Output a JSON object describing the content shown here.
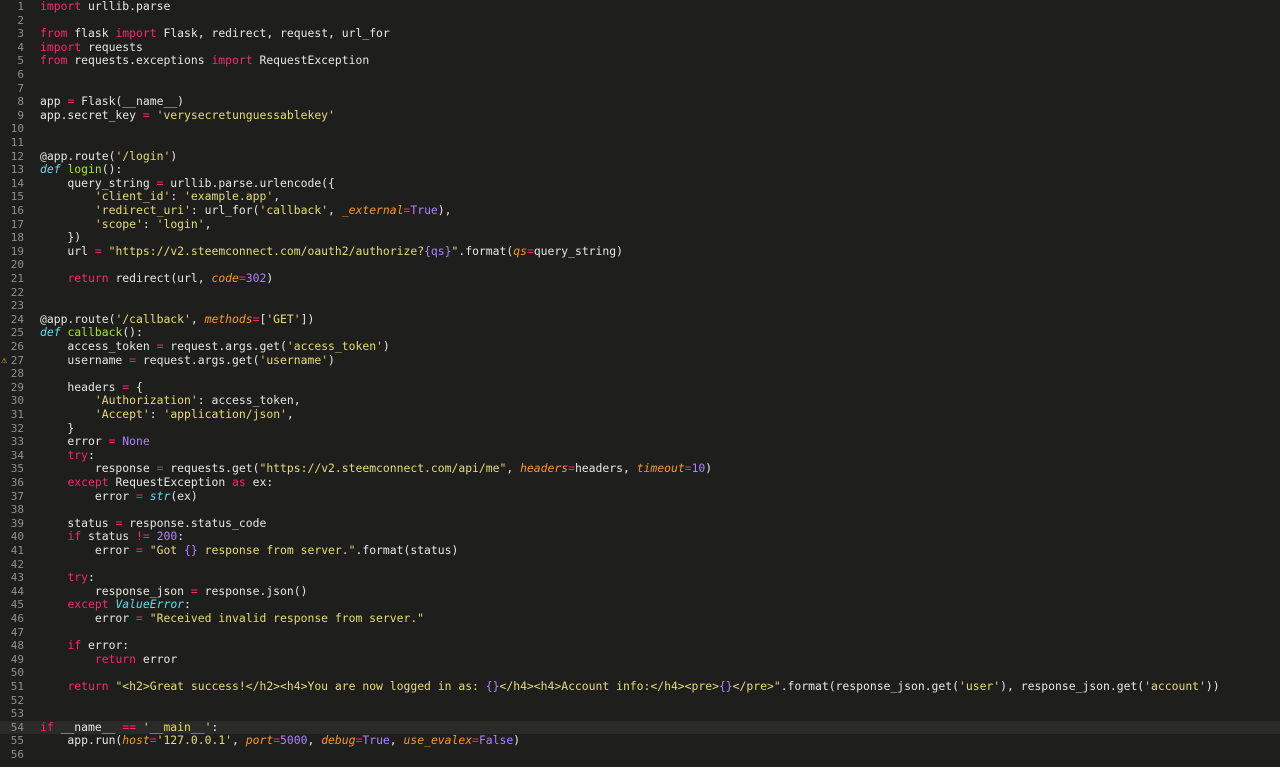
{
  "editor": {
    "warning_line": 27,
    "active_line": 54,
    "lines": [
      {
        "n": "1",
        "t": [
          [
            "kw",
            "import"
          ],
          [
            "plain",
            " urllib.parse"
          ]
        ]
      },
      {
        "n": "2",
        "t": []
      },
      {
        "n": "3",
        "t": [
          [
            "kw",
            "from"
          ],
          [
            "plain",
            " flask "
          ],
          [
            "kw",
            "import"
          ],
          [
            "plain",
            " Flask, redirect, request, url_for"
          ]
        ]
      },
      {
        "n": "4",
        "t": [
          [
            "kw",
            "import"
          ],
          [
            "plain",
            " requests"
          ]
        ]
      },
      {
        "n": "5",
        "t": [
          [
            "kw",
            "from"
          ],
          [
            "plain",
            " requests.exceptions "
          ],
          [
            "kw",
            "import"
          ],
          [
            "plain",
            " RequestException"
          ]
        ]
      },
      {
        "n": "6",
        "t": []
      },
      {
        "n": "7",
        "t": []
      },
      {
        "n": "8",
        "t": [
          [
            "plain",
            "app "
          ],
          [
            "op",
            "="
          ],
          [
            "plain",
            " Flask(__name__)"
          ]
        ]
      },
      {
        "n": "9",
        "t": [
          [
            "plain",
            "app.secret_key "
          ],
          [
            "op",
            "="
          ],
          [
            "plain",
            " "
          ],
          [
            "str",
            "'verysecretunguessablekey'"
          ]
        ]
      },
      {
        "n": "10",
        "t": []
      },
      {
        "n": "11",
        "t": []
      },
      {
        "n": "12",
        "t": [
          [
            "plain",
            "@app.route("
          ],
          [
            "str",
            "'/login'"
          ],
          [
            "plain",
            ")"
          ]
        ]
      },
      {
        "n": "13",
        "t": [
          [
            "kwi",
            "def"
          ],
          [
            "plain",
            " "
          ],
          [
            "fn",
            "login"
          ],
          [
            "plain",
            "():"
          ]
        ]
      },
      {
        "n": "14",
        "t": [
          [
            "plain",
            "    query_string "
          ],
          [
            "op",
            "="
          ],
          [
            "plain",
            " urllib.parse.urlencode({"
          ]
        ]
      },
      {
        "n": "15",
        "t": [
          [
            "plain",
            "        "
          ],
          [
            "str",
            "'client_id'"
          ],
          [
            "plain",
            ": "
          ],
          [
            "str",
            "'example.app'"
          ],
          [
            "plain",
            ","
          ]
        ]
      },
      {
        "n": "16",
        "t": [
          [
            "plain",
            "        "
          ],
          [
            "str",
            "'redirect_uri'"
          ],
          [
            "plain",
            ": url_for("
          ],
          [
            "str",
            "'callback'"
          ],
          [
            "plain",
            ", "
          ],
          [
            "param",
            "_external"
          ],
          [
            "op",
            "="
          ],
          [
            "num",
            "True"
          ],
          [
            "plain",
            "),"
          ]
        ]
      },
      {
        "n": "17",
        "t": [
          [
            "plain",
            "        "
          ],
          [
            "str",
            "'scope'"
          ],
          [
            "plain",
            ": "
          ],
          [
            "str",
            "'login'"
          ],
          [
            "plain",
            ","
          ]
        ]
      },
      {
        "n": "18",
        "t": [
          [
            "plain",
            "    })"
          ]
        ]
      },
      {
        "n": "19",
        "t": [
          [
            "plain",
            "    url "
          ],
          [
            "op",
            "="
          ],
          [
            "plain",
            " "
          ],
          [
            "str",
            "\"https://v2.steemconnect.com/oauth2/authorize?"
          ],
          [
            "interp",
            "{qs}"
          ],
          [
            "str",
            "\""
          ],
          [
            "plain",
            ".format("
          ],
          [
            "param",
            "qs"
          ],
          [
            "op",
            "="
          ],
          [
            "plain",
            "query_string)"
          ]
        ]
      },
      {
        "n": "20",
        "t": []
      },
      {
        "n": "21",
        "t": [
          [
            "plain",
            "    "
          ],
          [
            "kw",
            "return"
          ],
          [
            "plain",
            " redirect(url, "
          ],
          [
            "param",
            "code"
          ],
          [
            "op",
            "="
          ],
          [
            "num",
            "302"
          ],
          [
            "plain",
            ")"
          ]
        ]
      },
      {
        "n": "22",
        "t": []
      },
      {
        "n": "23",
        "t": []
      },
      {
        "n": "24",
        "t": [
          [
            "plain",
            "@app.route("
          ],
          [
            "str",
            "'/callback'"
          ],
          [
            "plain",
            ", "
          ],
          [
            "param",
            "methods"
          ],
          [
            "op",
            "="
          ],
          [
            "plain",
            "["
          ],
          [
            "str",
            "'GET'"
          ],
          [
            "plain",
            "])"
          ]
        ]
      },
      {
        "n": "25",
        "t": [
          [
            "kwi",
            "def"
          ],
          [
            "plain",
            " "
          ],
          [
            "fn",
            "callback"
          ],
          [
            "plain",
            "():"
          ]
        ]
      },
      {
        "n": "26",
        "t": [
          [
            "plain",
            "    access_token "
          ],
          [
            "op",
            "="
          ],
          [
            "plain",
            " request.args.get("
          ],
          [
            "str",
            "'access_token'"
          ],
          [
            "plain",
            ")"
          ]
        ]
      },
      {
        "n": "27",
        "t": [
          [
            "plain",
            "    username "
          ],
          [
            "op",
            "="
          ],
          [
            "plain",
            " request.args.get("
          ],
          [
            "str",
            "'username'"
          ],
          [
            "plain",
            ")"
          ]
        ]
      },
      {
        "n": "28",
        "t": []
      },
      {
        "n": "29",
        "t": [
          [
            "plain",
            "    headers "
          ],
          [
            "op",
            "="
          ],
          [
            "plain",
            " {"
          ]
        ]
      },
      {
        "n": "30",
        "t": [
          [
            "plain",
            "        "
          ],
          [
            "str",
            "'Authorization'"
          ],
          [
            "plain",
            ": access_token,"
          ]
        ]
      },
      {
        "n": "31",
        "t": [
          [
            "plain",
            "        "
          ],
          [
            "str",
            "'Accept'"
          ],
          [
            "plain",
            ": "
          ],
          [
            "str",
            "'application/json'"
          ],
          [
            "plain",
            ","
          ]
        ]
      },
      {
        "n": "32",
        "t": [
          [
            "plain",
            "    }"
          ]
        ]
      },
      {
        "n": "33",
        "t": [
          [
            "plain",
            "    error "
          ],
          [
            "op",
            "="
          ],
          [
            "plain",
            " "
          ],
          [
            "num",
            "None"
          ]
        ]
      },
      {
        "n": "34",
        "t": [
          [
            "plain",
            "    "
          ],
          [
            "kw",
            "try"
          ],
          [
            "plain",
            ":"
          ]
        ]
      },
      {
        "n": "35",
        "t": [
          [
            "plain",
            "        response "
          ],
          [
            "op",
            "="
          ],
          [
            "plain",
            " requests.get("
          ],
          [
            "str",
            "\"https://v2.steemconnect.com/api/me\""
          ],
          [
            "plain",
            ", "
          ],
          [
            "param",
            "headers"
          ],
          [
            "op",
            "="
          ],
          [
            "plain",
            "headers, "
          ],
          [
            "param",
            "timeout"
          ],
          [
            "op",
            "="
          ],
          [
            "num",
            "10"
          ],
          [
            "plain",
            ")"
          ]
        ]
      },
      {
        "n": "36",
        "t": [
          [
            "plain",
            "    "
          ],
          [
            "kw",
            "except"
          ],
          [
            "plain",
            " RequestException "
          ],
          [
            "kw",
            "as"
          ],
          [
            "plain",
            " ex:"
          ]
        ]
      },
      {
        "n": "37",
        "t": [
          [
            "plain",
            "        error "
          ],
          [
            "op",
            "="
          ],
          [
            "plain",
            " "
          ],
          [
            "builtin",
            "str"
          ],
          [
            "plain",
            "(ex)"
          ]
        ]
      },
      {
        "n": "38",
        "t": []
      },
      {
        "n": "39",
        "t": [
          [
            "plain",
            "    status "
          ],
          [
            "op",
            "="
          ],
          [
            "plain",
            " response.status_code"
          ]
        ]
      },
      {
        "n": "40",
        "t": [
          [
            "plain",
            "    "
          ],
          [
            "kw",
            "if"
          ],
          [
            "plain",
            " status "
          ],
          [
            "op",
            "!="
          ],
          [
            "plain",
            " "
          ],
          [
            "num",
            "200"
          ],
          [
            "plain",
            ":"
          ]
        ]
      },
      {
        "n": "41",
        "t": [
          [
            "plain",
            "        error "
          ],
          [
            "op",
            "="
          ],
          [
            "plain",
            " "
          ],
          [
            "str",
            "\"Got "
          ],
          [
            "interp",
            "{}"
          ],
          [
            "str",
            " response from server.\""
          ],
          [
            "plain",
            ".format(status)"
          ]
        ]
      },
      {
        "n": "42",
        "t": []
      },
      {
        "n": "43",
        "t": [
          [
            "plain",
            "    "
          ],
          [
            "kw",
            "try"
          ],
          [
            "plain",
            ":"
          ]
        ]
      },
      {
        "n": "44",
        "t": [
          [
            "plain",
            "        response_json "
          ],
          [
            "op",
            "="
          ],
          [
            "plain",
            " response.json()"
          ]
        ]
      },
      {
        "n": "45",
        "t": [
          [
            "plain",
            "    "
          ],
          [
            "kw",
            "except"
          ],
          [
            "plain",
            " "
          ],
          [
            "builtin",
            "ValueError"
          ],
          [
            "plain",
            ":"
          ]
        ]
      },
      {
        "n": "46",
        "t": [
          [
            "plain",
            "        error "
          ],
          [
            "op",
            "="
          ],
          [
            "plain",
            " "
          ],
          [
            "str",
            "\"Received invalid response from server.\""
          ]
        ]
      },
      {
        "n": "47",
        "t": []
      },
      {
        "n": "48",
        "t": [
          [
            "plain",
            "    "
          ],
          [
            "kw",
            "if"
          ],
          [
            "plain",
            " error:"
          ]
        ]
      },
      {
        "n": "49",
        "t": [
          [
            "plain",
            "        "
          ],
          [
            "kw",
            "return"
          ],
          [
            "plain",
            " error"
          ]
        ]
      },
      {
        "n": "50",
        "t": []
      },
      {
        "n": "51",
        "t": [
          [
            "plain",
            "    "
          ],
          [
            "kw",
            "return"
          ],
          [
            "plain",
            " "
          ],
          [
            "str",
            "\"<h2>Great success!</h2><h4>You are now logged in as: "
          ],
          [
            "interp",
            "{}"
          ],
          [
            "str",
            "</h4><h4>Account info:</h4><pre>"
          ],
          [
            "interp",
            "{}"
          ],
          [
            "str",
            "</pre>\""
          ],
          [
            "plain",
            ".format(response_json.get("
          ],
          [
            "str",
            "'user'"
          ],
          [
            "plain",
            "), response_json.get("
          ],
          [
            "str",
            "'account'"
          ],
          [
            "plain",
            "))"
          ]
        ]
      },
      {
        "n": "52",
        "t": []
      },
      {
        "n": "53",
        "t": []
      },
      {
        "n": "54",
        "t": [
          [
            "kw",
            "if"
          ],
          [
            "plain",
            " __name__ "
          ],
          [
            "op",
            "=="
          ],
          [
            "plain",
            " "
          ],
          [
            "str",
            "'__main__'"
          ],
          [
            "plain",
            ":"
          ]
        ]
      },
      {
        "n": "55",
        "t": [
          [
            "plain",
            "    app.run("
          ],
          [
            "param",
            "host"
          ],
          [
            "op",
            "="
          ],
          [
            "str",
            "'127.0.0.1'"
          ],
          [
            "plain",
            ", "
          ],
          [
            "param",
            "port"
          ],
          [
            "op",
            "="
          ],
          [
            "num",
            "5000"
          ],
          [
            "plain",
            ", "
          ],
          [
            "param",
            "debug"
          ],
          [
            "op",
            "="
          ],
          [
            "num",
            "True"
          ],
          [
            "plain",
            ", "
          ],
          [
            "param",
            "use_evalex"
          ],
          [
            "op",
            "="
          ],
          [
            "num",
            "False"
          ],
          [
            "plain",
            ")"
          ]
        ]
      },
      {
        "n": "56",
        "t": []
      }
    ]
  }
}
